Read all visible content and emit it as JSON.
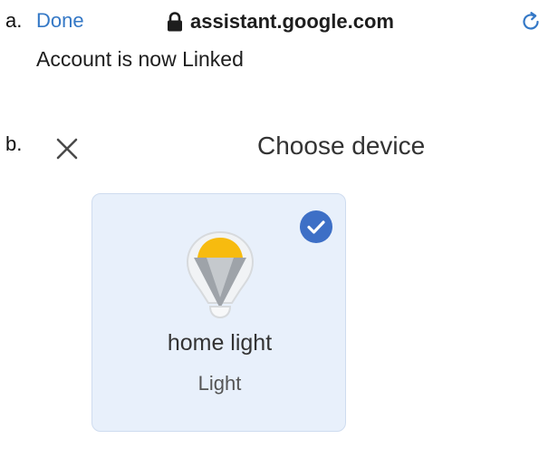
{
  "labels": {
    "a": "a.",
    "b": "b."
  },
  "browser": {
    "done_label": "Done",
    "url": "assistant.google.com",
    "icons": {
      "lock": "lock-icon",
      "reload": "reload-icon"
    }
  },
  "account_status": "Account is now Linked",
  "dialog": {
    "title": "Choose device",
    "close_icon": "close-icon"
  },
  "device": {
    "name": "home light",
    "type": "Light",
    "selected": true,
    "icon": "light-bulb-icon"
  },
  "colors": {
    "link_blue": "#3478c6",
    "check_blue": "#3d6fc6",
    "card_bg": "#e8f0fb",
    "bulb_yellow": "#f7bb0f"
  }
}
